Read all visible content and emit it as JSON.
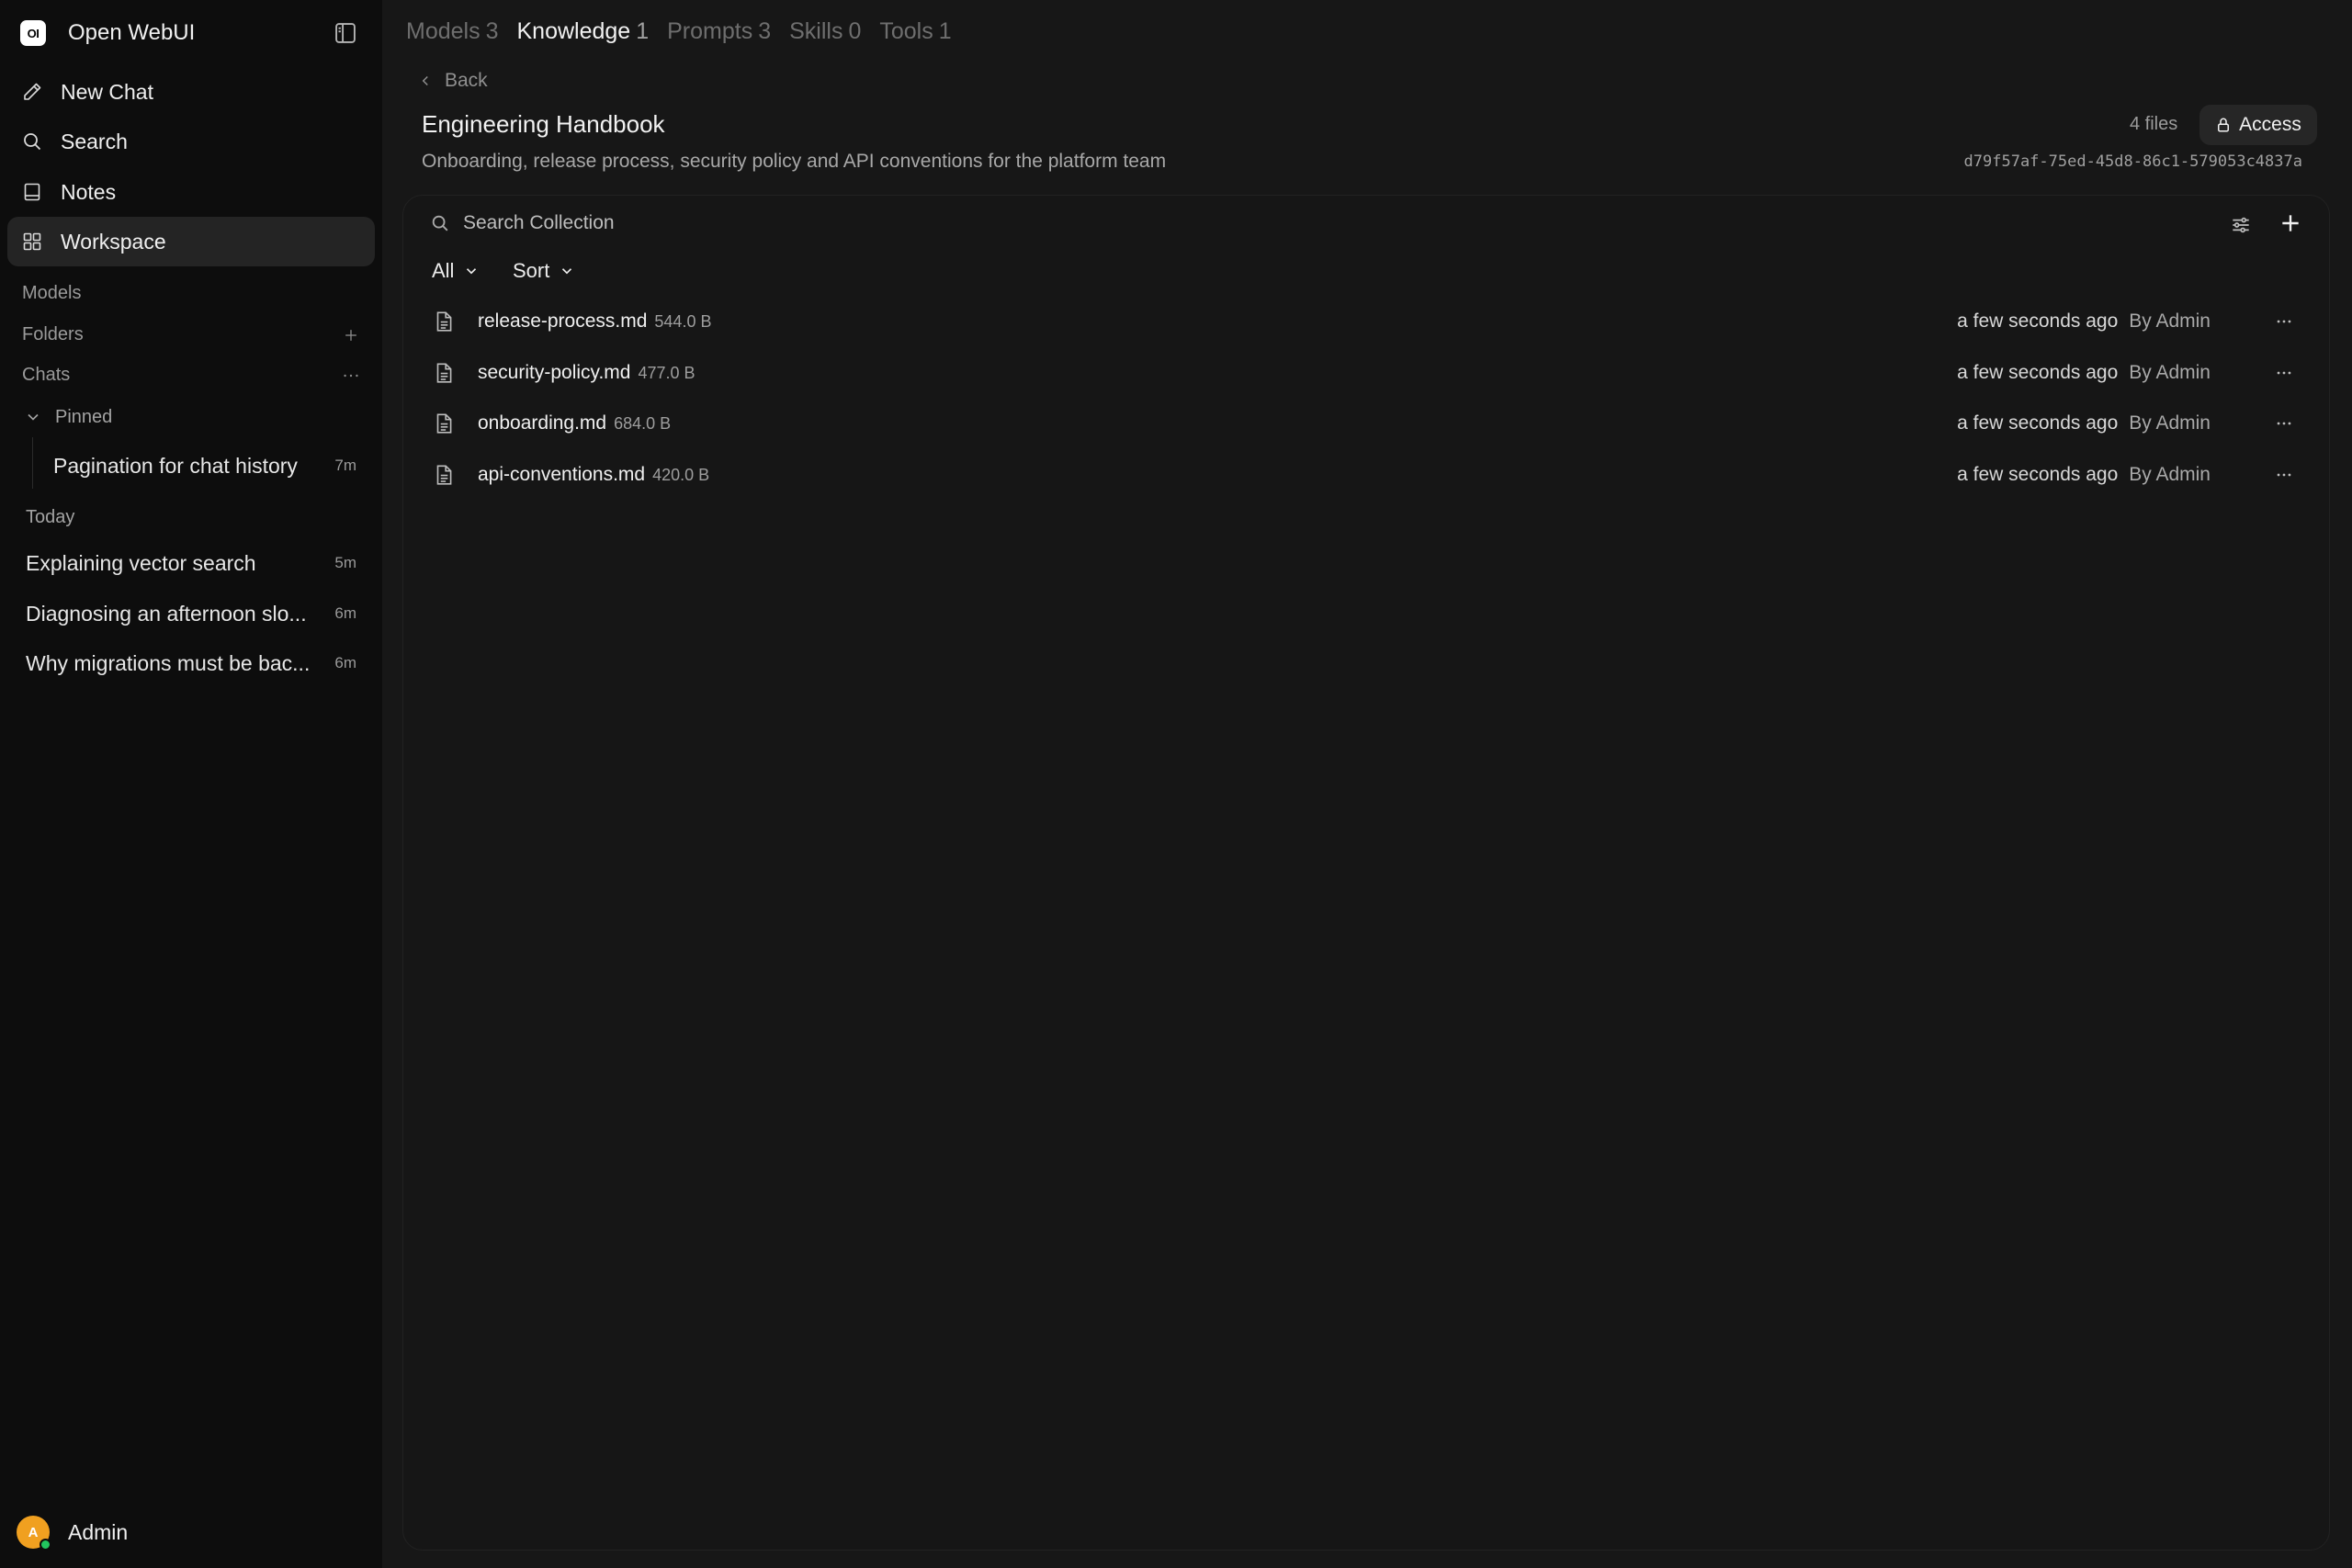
{
  "app": {
    "logo_text": "OI",
    "name": "Open WebUI"
  },
  "sidebar": {
    "nav": [
      {
        "label": "New Chat",
        "icon": "pencil-icon"
      },
      {
        "label": "Search",
        "icon": "search-icon"
      },
      {
        "label": "Notes",
        "icon": "notes-icon"
      },
      {
        "label": "Workspace",
        "icon": "grid-icon"
      }
    ],
    "models_label": "Models",
    "folders_label": "Folders",
    "chats_label": "Chats",
    "pinned_label": "Pinned",
    "pinned_chats": [
      {
        "title": "Pagination for chat history",
        "age": "7m"
      }
    ],
    "today_label": "Today",
    "today_chats": [
      {
        "title": "Explaining vector search",
        "age": "5m"
      },
      {
        "title": "Diagnosing an afternoon slo...",
        "age": "6m"
      },
      {
        "title": "Why migrations must be bac...",
        "age": "6m"
      }
    ],
    "user": {
      "initial": "A",
      "name": "Admin",
      "status_color": "#22c55e",
      "avatar_color": "#f0a020"
    }
  },
  "tabs": [
    {
      "label": "Models",
      "count": "3"
    },
    {
      "label": "Knowledge",
      "count": "1",
      "active": true
    },
    {
      "label": "Prompts",
      "count": "3"
    },
    {
      "label": "Skills",
      "count": "0"
    },
    {
      "label": "Tools",
      "count": "1"
    }
  ],
  "back_label": "Back",
  "knowledge": {
    "title": "Engineering Handbook",
    "description": "Onboarding, release process, security policy and API conventions for the platform team",
    "file_count": "4 files",
    "access_label": "Access",
    "id": "d79f57af-75ed-45d8-86c1-579053c4837a"
  },
  "search": {
    "placeholder": "Search Collection"
  },
  "filters": {
    "all_label": "All",
    "sort_label": "Sort"
  },
  "files": [
    {
      "name": "release-process.md",
      "size": "544.0 B",
      "time": "a few seconds ago",
      "by": "By Admin"
    },
    {
      "name": "security-policy.md",
      "size": "477.0 B",
      "time": "a few seconds ago",
      "by": "By Admin"
    },
    {
      "name": "onboarding.md",
      "size": "684.0 B",
      "time": "a few seconds ago",
      "by": "By Admin"
    },
    {
      "name": "api-conventions.md",
      "size": "420.0 B",
      "time": "a few seconds ago",
      "by": "By Admin"
    }
  ]
}
